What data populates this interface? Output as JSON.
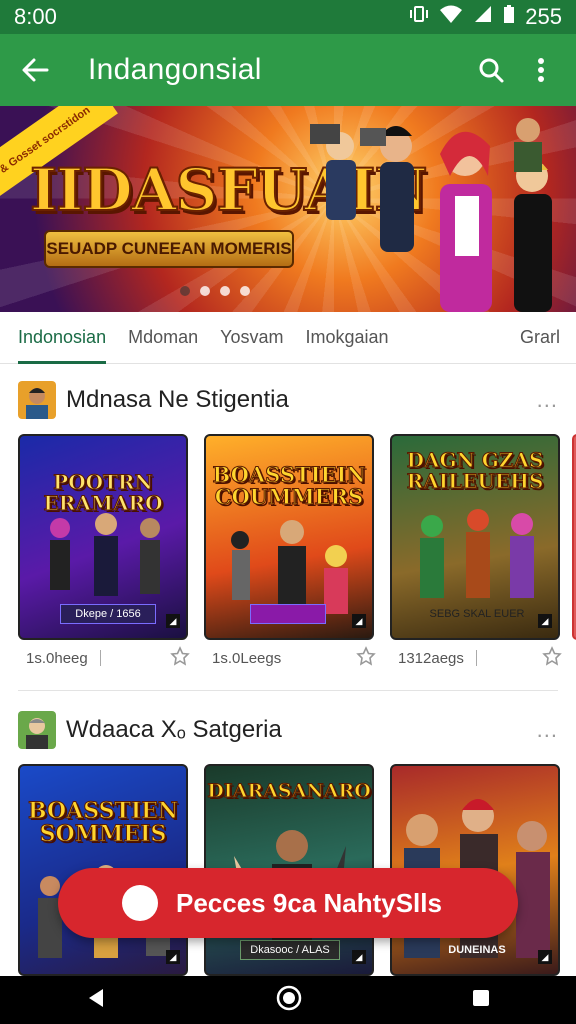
{
  "status_bar": {
    "time": "8:00",
    "battery": "255"
  },
  "app_bar": {
    "title": "Indangonsial"
  },
  "banner": {
    "ribbon_text": "& Gosset socrstidon",
    "title": "IIDASFUAIN",
    "subtitle": "SEUADP CUNEEAN MOMERIS",
    "slide_count": 4,
    "active_slide": 0
  },
  "tabs": [
    {
      "label": "Indonosian",
      "active": true
    },
    {
      "label": "Mdoman",
      "active": false
    },
    {
      "label": "Yosvam",
      "active": false
    },
    {
      "label": "Imokgaian",
      "active": false
    },
    {
      "label": "Grarl",
      "active": false
    }
  ],
  "sections": [
    {
      "title": "Mdnasa Ne Stigentia",
      "more": "...",
      "cards": [
        {
          "cover_title": "POOTRN ERAMARO",
          "tag": "Dkepe / 1656",
          "meta": "1s.0heeg"
        },
        {
          "cover_title": "BOASSTIEIN COUMMERS",
          "tag": "",
          "meta": "1s.0Leegs"
        },
        {
          "cover_title": "DAGN GZAS RAILEUEHS",
          "tag": "SEBG SKAL EUER",
          "meta": "1312aegs"
        }
      ]
    },
    {
      "title": "Wdaaca Xₒ Satgeria",
      "more": "...",
      "cards": [
        {
          "cover_title": "BOASSTIEN SOMMEIS",
          "tag": "",
          "meta": ""
        },
        {
          "cover_title": "DIARASANARO",
          "tag": "Dkasooc / ALAS",
          "meta": ""
        },
        {
          "cover_title": "",
          "tag": "DUNEINAS",
          "meta": ""
        }
      ]
    }
  ],
  "cta": {
    "label": "Pecces 9ca NahtySlls"
  },
  "colors": {
    "status_bar": "#1f7a3a",
    "app_bar": "#2e9a48",
    "accent": "#1a6b45",
    "cta": "#d7262d"
  }
}
